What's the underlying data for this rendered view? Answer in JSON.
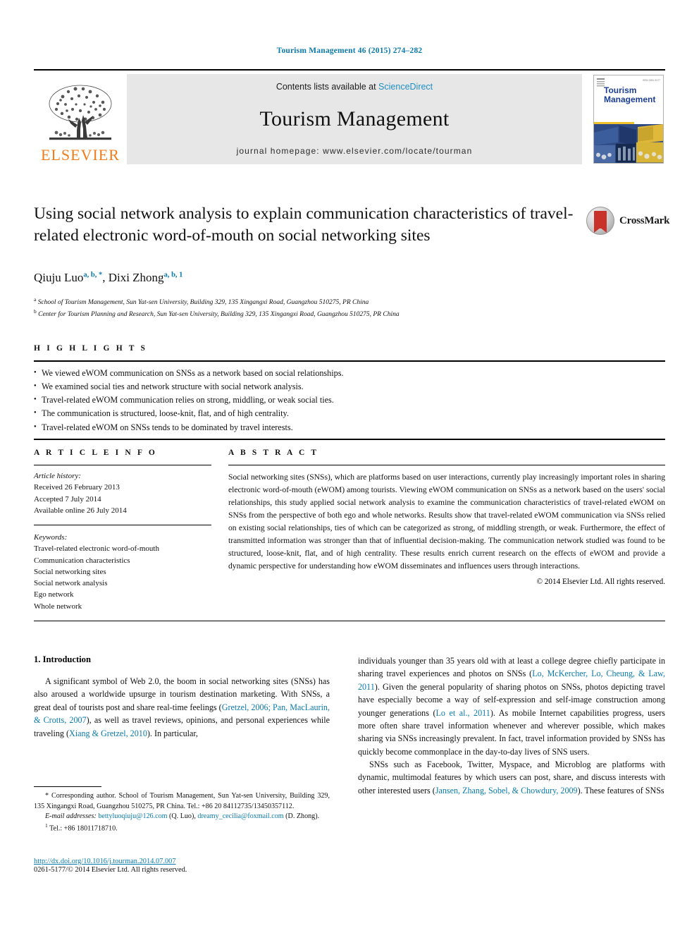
{
  "running_head": "Tourism Management 46 (2015) 274–282",
  "masthead": {
    "publisher_logo_text": "ELSEVIER",
    "contents_prefix": "Contents lists available at ",
    "contents_link": "ScienceDirect",
    "journal_name": "Tourism Management",
    "homepage_line": "journal homepage: www.elsevier.com/locate/tourman",
    "cover": {
      "title_line1": "Tourism",
      "title_line2": "Management",
      "issn_note": "ISSN 0261-5177"
    }
  },
  "article": {
    "title": "Using social network analysis to explain communication characteristics of travel-related electronic word-of-mouth on social networking sites",
    "crossmark_label": "CrossMark",
    "authors": [
      {
        "name": "Qiuju Luo",
        "marks": "a, b, *"
      },
      {
        "name": "Dixi Zhong",
        "marks": "a, b, 1"
      }
    ],
    "affiliations": [
      {
        "mark": "a",
        "text": "School of Tourism Management, Sun Yat-sen University, Building 329, 135 Xingangxi Road, Guangzhou 510275, PR China"
      },
      {
        "mark": "b",
        "text": "Center for Tourism Planning and Research, Sun Yat-sen University, Building 329, 135 Xingangxi Road, Guangzhou 510275, PR China"
      }
    ]
  },
  "highlights": {
    "heading": "H I G H L I G H T S",
    "items": [
      "We viewed eWOM communication on SNSs as a network based on social relationships.",
      "We examined social ties and network structure with social network analysis.",
      "Travel-related eWOM communication relies on strong, middling, or weak social ties.",
      "The communication is structured, loose-knit, flat, and of high centrality.",
      "Travel-related eWOM on SNSs tends to be dominated by travel interests."
    ]
  },
  "article_info": {
    "heading": "A R T I C L E   I N F O",
    "history_label": "Article history:",
    "history": [
      "Received 26 February 2013",
      "Accepted 7 July 2014",
      "Available online 26 July 2014"
    ],
    "keywords_label": "Keywords:",
    "keywords": [
      "Travel-related electronic word-of-mouth",
      "Communication characteristics",
      "Social networking sites",
      "Social network analysis",
      "Ego network",
      "Whole network"
    ]
  },
  "abstract": {
    "heading": "A B S T R A C T",
    "text": "Social networking sites (SNSs), which are platforms based on user interactions, currently play increasingly important roles in sharing electronic word-of-mouth (eWOM) among tourists. Viewing eWOM communication on SNSs as a network based on the users' social relationships, this study applied social network analysis to examine the communication characteristics of travel-related eWOM on SNSs from the perspective of both ego and whole networks. Results show that travel-related eWOM communication via SNSs relied on existing social relationships, ties of which can be categorized as strong, of middling strength, or weak. Furthermore, the effect of transmitted information was stronger than that of influential decision-making. The communication network studied was found to be structured, loose-knit, flat, and of high centrality. These results enrich current research on the effects of eWOM and provide a dynamic perspective for understanding how eWOM disseminates and influences users through interactions.",
    "copyright": "© 2014 Elsevier Ltd. All rights reserved."
  },
  "body": {
    "section_heading": "1. Introduction",
    "left_paragraph_1_part1": "A significant symbol of Web 2.0, the boom in social networking sites (SNSs) has also aroused a worldwide upsurge in tourism destination marketing. With SNSs, a great deal of tourists post and share real-time feelings (",
    "left_ref_1": "Gretzel, 2006; Pan, MacLaurin, & Crotts, 2007",
    "left_paragraph_1_part2": "), as well as travel reviews, opinions, and personal experiences while traveling (",
    "left_ref_2": "Xiang & Gretzel, 2010",
    "left_paragraph_1_part3": "). In particular,",
    "right_paragraph_1_part1": "individuals younger than 35 years old with at least a college degree chiefly participate in sharing travel experiences and photos on SNSs (",
    "right_ref_1": "Lo, McKercher, Lo, Cheung, & Law, 2011",
    "right_paragraph_1_part2": "). Given the general popularity of sharing photos on SNSs, photos depicting travel have especially become a way of self-expression and self-image construction among younger generations (",
    "right_ref_2": "Lo et al., 2011",
    "right_paragraph_1_part3": "). As mobile Internet capabilities progress, users more often share travel information whenever and wherever possible, which makes sharing via SNSs increasingly prevalent. In fact, travel information provided by SNSs has quickly become commonplace in the day-to-day lives of SNS users.",
    "right_paragraph_2_part1": "SNSs such as Facebook, Twitter, Myspace, and Microblog are platforms with dynamic, multimodal features by which users can post, share, and discuss interests with other interested users (",
    "right_ref_3": "Jansen, Zhang, Sobel, & Chowdury, 2009",
    "right_paragraph_2_part2": "). These features of SNSs"
  },
  "footnotes": {
    "corresponding": "* Corresponding author. School of Tourism Management, Sun Yat-sen University, Building 329, 135 Xingangxi Road, Guangzhou 510275, PR China. Tel.: +86 20 84112735/13450357112.",
    "email_label": "E-mail addresses:",
    "email_1": "bettyluoqiuju@126.com",
    "email_1_owner": " (Q. Luo), ",
    "email_2": "dreamy_cecilia@foxmail.com",
    "email_2_owner": " (D. Zhong).",
    "tel_mark": "1",
    "tel": " Tel.: +86 18011718710."
  },
  "footer": {
    "doi": "http://dx.doi.org/10.1016/j.tourman.2014.07.007",
    "issn_line": "0261-5177/© 2014 Elsevier Ltd. All rights reserved."
  },
  "colors": {
    "link_blue": "#0b7aab",
    "sciencedirect_blue": "#1e8fc4",
    "elsevier_orange": "#f07c1b",
    "cover_blue": "#1c3f94",
    "crossmark_red": "#c8322a"
  }
}
